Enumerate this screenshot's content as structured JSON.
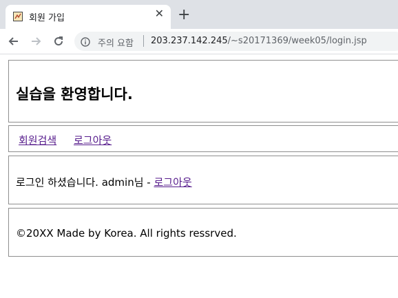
{
  "browser": {
    "tab": {
      "title": "회원 가입",
      "close_glyph": "✕",
      "favicon": "page-favicon"
    },
    "new_tab_glyph": "+",
    "nav": {
      "back_icon": "arrow-left-icon",
      "forward_icon": "arrow-right-icon",
      "reload_icon": "reload-icon"
    },
    "address": {
      "security_label": "주의 요함",
      "url_host": "203.237.142.245",
      "url_path": "/~s20171369/week05/login.jsp"
    }
  },
  "page": {
    "header": {
      "title": "실습을 환영합니다."
    },
    "nav": {
      "links": [
        {
          "label": "회원검색"
        },
        {
          "label": "로그아웃"
        }
      ]
    },
    "login": {
      "message": "로그인 하셨습니다. admin님 - ",
      "logout_label": "로그아웃"
    },
    "footer": {
      "copyright": "©20XX Made by Korea. All rights ressrved."
    }
  },
  "colors": {
    "visited_link": "#551a8b",
    "tabstrip": "#dee1e6",
    "omnibox": "#f1f3f4"
  }
}
